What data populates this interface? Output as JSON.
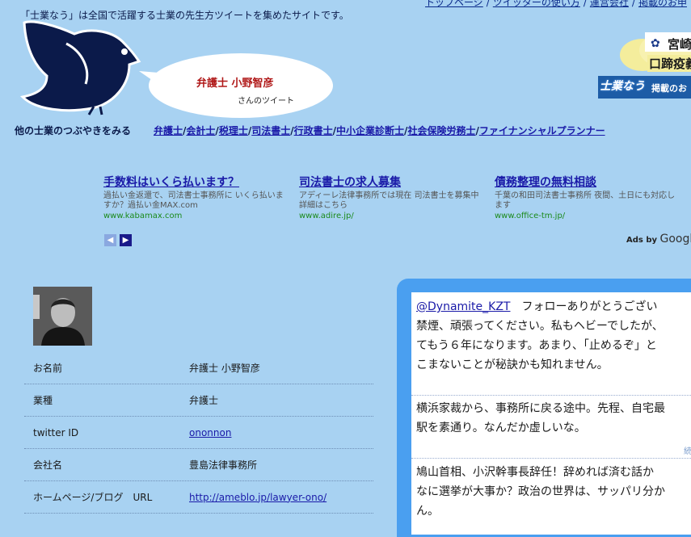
{
  "header": {
    "tagline": "「士業なう」は全国で活躍する士業の先生方ツイートを集めたサイトです。",
    "topnav": [
      "トップページ",
      "ツイッターの使い方",
      "運営会社",
      "掲載のお申"
    ],
    "bubble_name": "弁護士 小野智彦",
    "bubble_sub": "さんのツイート"
  },
  "banners": {
    "cloud_line1": "宮崎",
    "cloud_line2": "口蹄疫義",
    "blue_logo": "士業なう",
    "blue_text": "掲載のお"
  },
  "categories": {
    "label": "他の士業のつぶやきをみる",
    "links": [
      "弁護士",
      "会計士",
      "税理士",
      "司法書士",
      "行政書士",
      "中小企業診断士",
      "社会保険労務士",
      "ファイナンシャルプランナー"
    ]
  },
  "ads": [
    {
      "title": "手数料はいくら払います？",
      "desc": "過払い金返還で、司法書士事務所に いくら払いますか？過払い金MAX.com",
      "url": "www.kabamax.com"
    },
    {
      "title": "司法書士の求人募集",
      "desc": "アディーレ法律事務所では現在 司法書士を募集中 詳細はこちら",
      "url": "www.adire.jp/"
    },
    {
      "title": "債務整理の無料相談",
      "desc": "千葉の和田司法書士事務所 夜間、土日にも対応します",
      "url": "www.office-tm.jp/"
    }
  ],
  "ads_by": "Ads by",
  "ads_google": "Google",
  "profile": [
    {
      "label": "お名前",
      "value": "弁護士 小野智彦",
      "link": false
    },
    {
      "label": "業種",
      "value": "弁護士",
      "link": false
    },
    {
      "label": "twitter ID",
      "value": "ononnon",
      "link": true
    },
    {
      "label": "会社名",
      "value": "豊島法律事務所",
      "link": false
    },
    {
      "label": "ホームページ/ブログ　URL",
      "value": "http://ameblo.jp/lawyer-ono/",
      "link": true
    }
  ],
  "tweets": [
    {
      "mention": "@Dynamite_KZT",
      "lines": [
        "　フォローありがとうござい",
        "禁煙、頑張ってください。私もヘビーでしたが、",
        "てもう６年になります。あまり、「止めるぞ」と",
        "こまないことが秘訣かも知れません。"
      ]
    },
    {
      "lines": [
        "横浜家裁から、事務所に戻る途中。先程、自宅最",
        "駅を素通り。なんだか虚しいな。"
      ]
    },
    {
      "lines": [
        "鳩山首相、小沢幹事長辞任！辞めれば済む話か",
        "なに選挙が大事か？政治の世界は、サッパリ分か",
        "ん。"
      ]
    }
  ],
  "tweet_more": "続"
}
